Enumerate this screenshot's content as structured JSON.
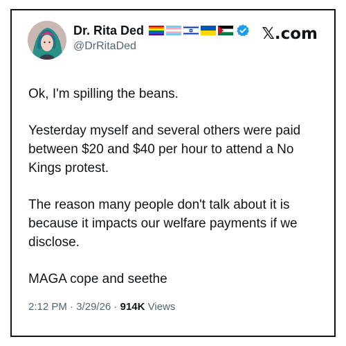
{
  "author": {
    "display_name": "Dr. Rita Ded",
    "handle": "@DrRitaDed",
    "verified": true,
    "flags": [
      "rainbow-pride-flag",
      "transgender-pride-flag",
      "israel-flag",
      "ukraine-flag",
      "palestine-flag"
    ]
  },
  "brand": "𝕏.com",
  "post": {
    "paragraphs": [
      "Ok, I'm spilling the beans.",
      "Yesterday myself and several others were paid between $20 and $40 per hour to attend a No Kings protest.",
      "The reason many people don't talk about it is because it impacts our welfare payments if we disclose.",
      "MAGA cope and seethe"
    ]
  },
  "meta": {
    "time": "2:12 PM",
    "separator": " · ",
    "date": "3/29/26",
    "views_count": "914K",
    "views_label": " Views"
  },
  "colors": {
    "text": "#0f1419",
    "secondary": "#536471",
    "verified": "#1d9bf0"
  }
}
